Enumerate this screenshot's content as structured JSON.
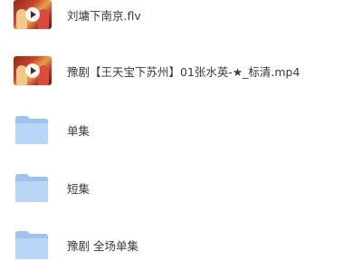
{
  "files": [
    {
      "name": "刘墉下南京.flv",
      "type": "video"
    },
    {
      "name": "豫剧【王天宝下苏州】01张水英-★_标清.mp4",
      "type": "video"
    },
    {
      "name": "单集",
      "type": "folder"
    },
    {
      "name": "短集",
      "type": "folder"
    },
    {
      "name": "豫剧 全场单集",
      "type": "folder"
    }
  ]
}
